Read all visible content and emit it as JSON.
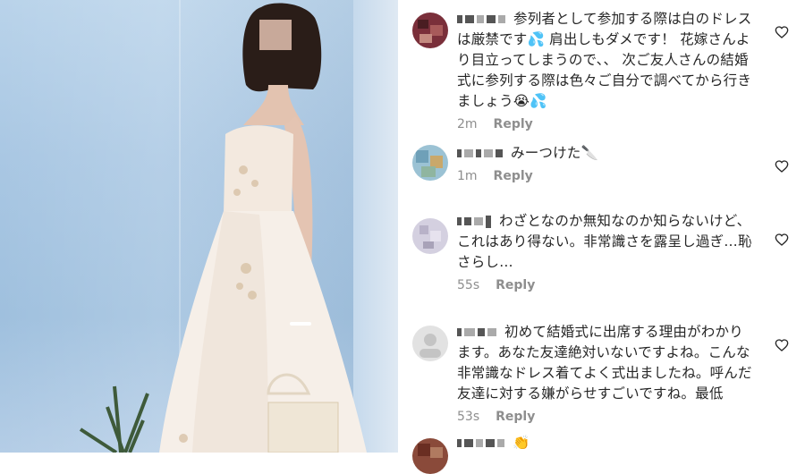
{
  "comments": [
    {
      "text": "参列者として参加する際は白のドレスは厳禁です💦 肩出しもダメです！ 花嫁さんより目立ってしまうので、、 次ご友人さんの結婚式に参列する際は色々ご自分で調べてから行きましょう😭💦",
      "time": "2m",
      "reply": "Reply",
      "avatar_color": "#7a2f3a"
    },
    {
      "text": "みーつけた🔪",
      "time": "1m",
      "reply": "Reply",
      "avatar_color": "#7fb0c8"
    },
    {
      "text": "わざとなのか無知なのか知らないけど、これはあり得ない。非常識さを露呈し過ぎ…恥さらし…",
      "time": "55s",
      "reply": "Reply",
      "avatar_color": "#c8c4d6"
    },
    {
      "text": "初めて結婚式に出席する理由がわかります。あなた友達絶対いないですよね。こんな非常識なドレス着てよく式出ましたね。呼んだ友達に対する嫌がらせすごいですね。最低",
      "time": "53s",
      "reply": "Reply",
      "avatar_color": "#d8d8d8"
    },
    {
      "text": "👏",
      "time": "",
      "reply": "",
      "avatar_color": "#8a4a3a"
    }
  ],
  "icons": {
    "like": "heart-outline-icon"
  }
}
